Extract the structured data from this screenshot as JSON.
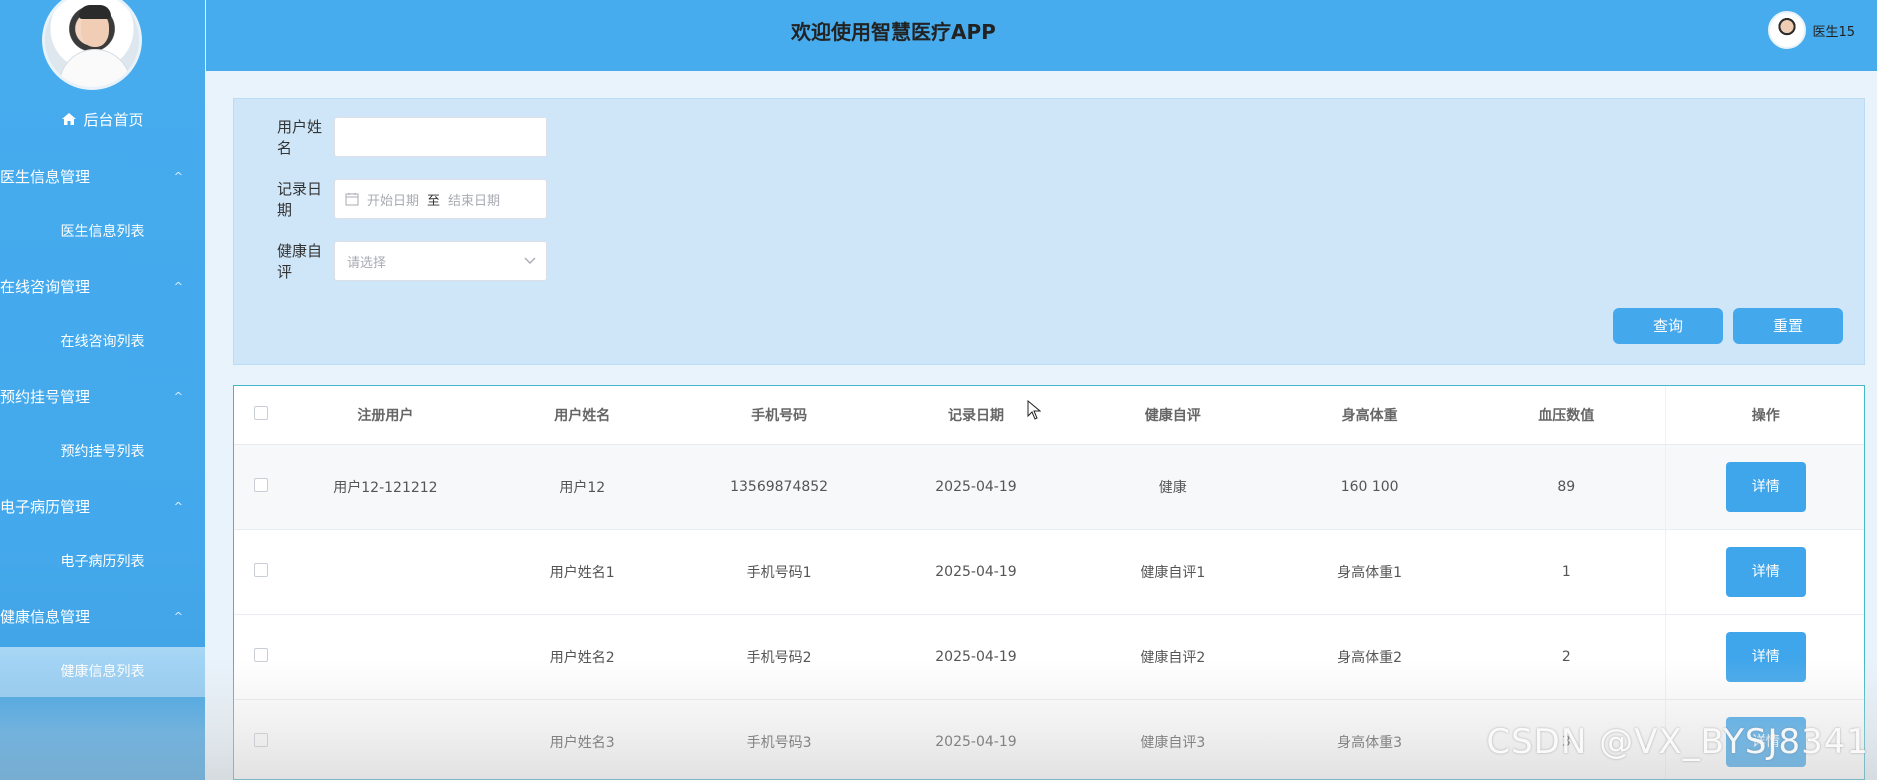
{
  "app": {
    "title": "欢迎使用智慧医疗APP",
    "user_name": "医生15"
  },
  "sidebar": {
    "home_label": "后台首页",
    "groups": [
      {
        "label": "医生信息管理",
        "sub": "医生信息列表"
      },
      {
        "label": "在线咨询管理",
        "sub": "在线咨询列表"
      },
      {
        "label": "预约挂号管理",
        "sub": "预约挂号列表"
      },
      {
        "label": "电子病历管理",
        "sub": "电子病历列表"
      },
      {
        "label": "健康信息管理",
        "sub": "健康信息列表"
      }
    ],
    "chevron_glyph": "^"
  },
  "search": {
    "name_label": "用户姓名",
    "name_value": "",
    "date_label": "记录日期",
    "date_start_placeholder": "开始日期",
    "date_sep": "至",
    "date_end_placeholder": "结束日期",
    "self_label": "健康自评",
    "self_placeholder": "请选择",
    "query_btn": "查询",
    "reset_btn": "重置"
  },
  "table": {
    "headers": [
      "注册用户",
      "用户姓名",
      "手机号码",
      "记录日期",
      "健康自评",
      "身高体重",
      "血压数值",
      "操作"
    ],
    "rows": [
      {
        "user": "用户12-121212",
        "name": "用户12",
        "phone": "13569874852",
        "date": "2025-04-19",
        "self": "健康",
        "hw": "160 100",
        "bp": "89",
        "op": "详情"
      },
      {
        "user": "",
        "name": "用户姓名1",
        "phone": "手机号码1",
        "date": "2025-04-19",
        "self": "健康自评1",
        "hw": "身高体重1",
        "bp": "1",
        "op": "详情"
      },
      {
        "user": "",
        "name": "用户姓名2",
        "phone": "手机号码2",
        "date": "2025-04-19",
        "self": "健康自评2",
        "hw": "身高体重2",
        "bp": "2",
        "op": "详情"
      },
      {
        "user": "",
        "name": "用户姓名3",
        "phone": "手机号码3",
        "date": "2025-04-19",
        "self": "健康自评3",
        "hw": "身高体重3",
        "bp": "3",
        "op": "详情"
      }
    ]
  },
  "watermark": "CSDN @VX_BYSJ8341",
  "colors": {
    "sidebar_bg": "#46acee",
    "header_bg": "#47acee",
    "panel_bg": "#cfe6f8",
    "button_bg": "#44a8ec",
    "active_menu": "#a9d7f5"
  }
}
